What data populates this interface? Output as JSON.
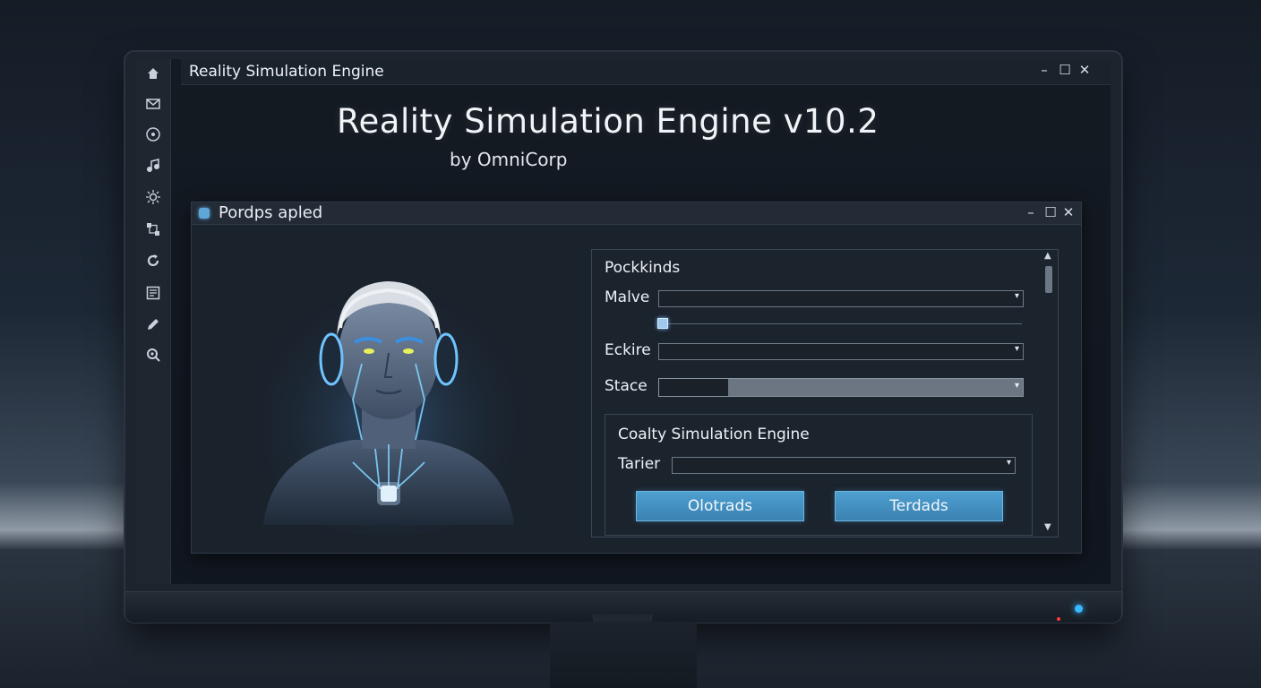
{
  "window": {
    "title": "Reality Simulation Engine",
    "controls": {
      "minimize": "–",
      "maximize": "☐",
      "close": "✕"
    }
  },
  "sidebar": {
    "icons": [
      "home-icon",
      "mail-icon",
      "disc-icon",
      "music-icon",
      "brightness-icon",
      "network-icon",
      "refresh-icon",
      "document-icon",
      "pen-icon",
      "search-icon"
    ]
  },
  "hero": {
    "title": "Reality Simulation Engine v10.2",
    "subtitle": "by OmniCorp"
  },
  "dialog": {
    "title": "Pordps apled",
    "controls": {
      "minimize": "–",
      "maximize": "☐",
      "close": "✕"
    },
    "panel": {
      "heading": "Pockkinds",
      "malve_label": "Malve",
      "malve_value": "",
      "slider_value": 0,
      "eckire_label": "Eckire",
      "eckire_value": "",
      "stace_label": "Stace",
      "stace_progress": 0.19,
      "subpanel": {
        "heading": "Coalty Simulation Engine",
        "tarier_label": "Tarier",
        "tarier_value": "",
        "button_left": "Olotrads",
        "button_right": "Terdads"
      }
    }
  },
  "colors": {
    "accent": "#4e9fd0",
    "glow": "#7fd0ff",
    "led": "#38b8ff"
  }
}
